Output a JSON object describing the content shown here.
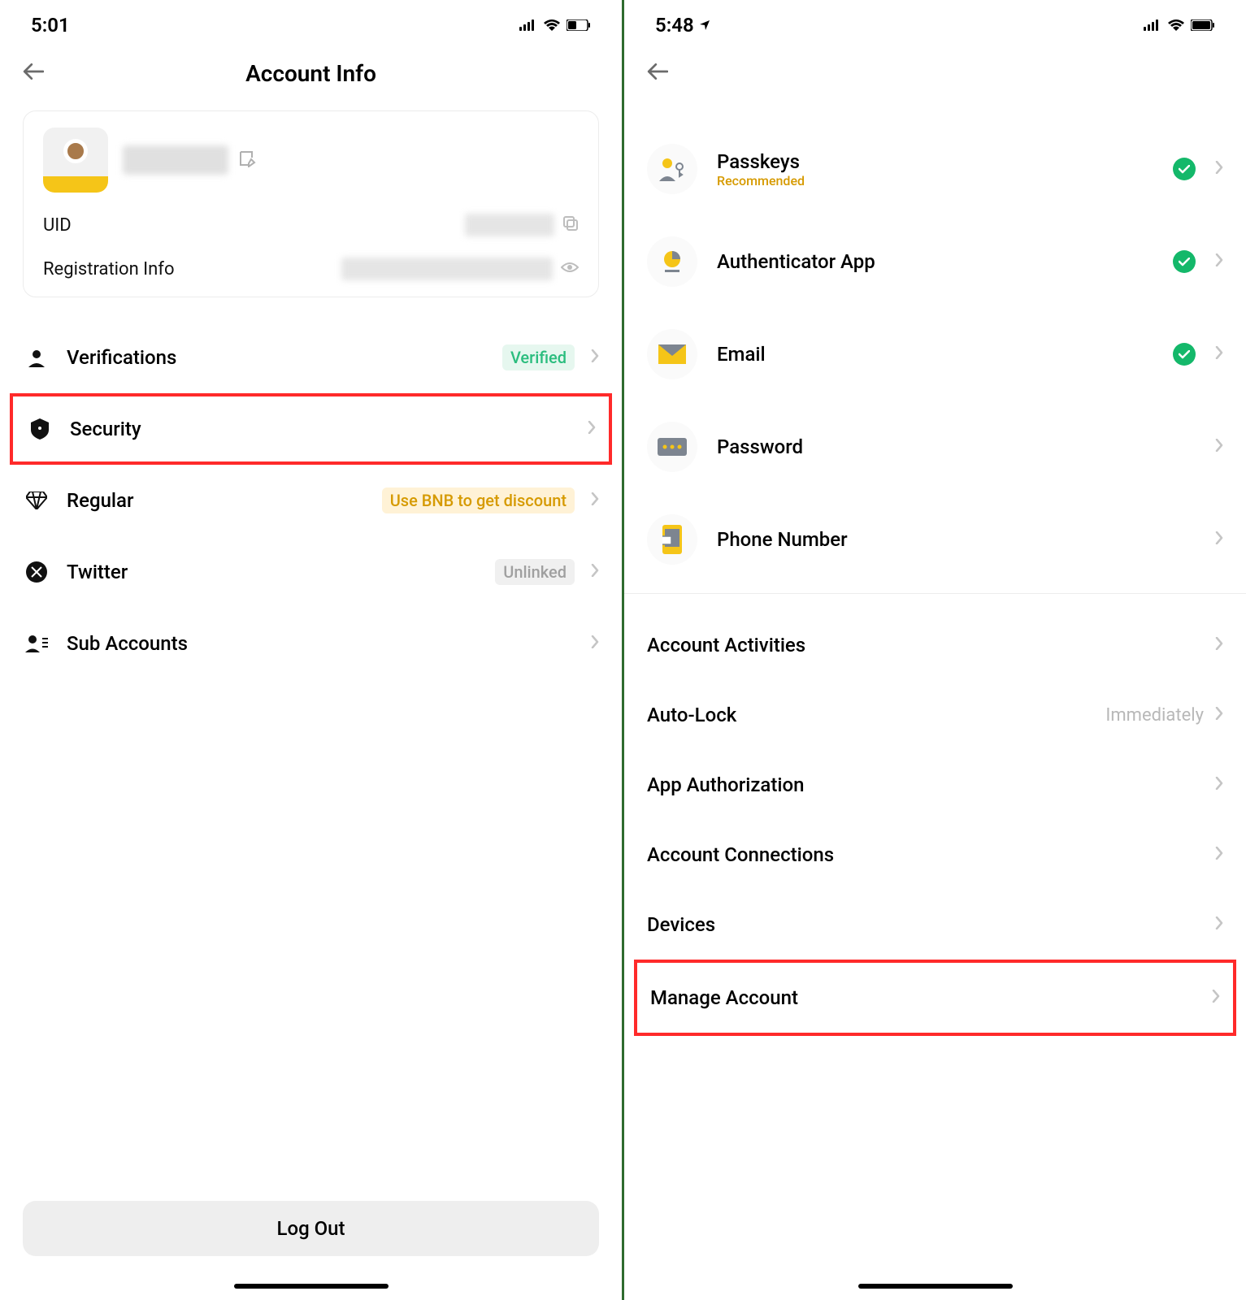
{
  "left": {
    "status": {
      "time": "5:01"
    },
    "title": "Account Info",
    "card": {
      "uid_label": "UID",
      "reg_label": "Registration Info"
    },
    "menu": {
      "verifications": {
        "label": "Verifications",
        "badge": "Verified"
      },
      "security": {
        "label": "Security"
      },
      "regular": {
        "label": "Regular",
        "badge": "Use BNB to get discount"
      },
      "twitter": {
        "label": "Twitter",
        "badge": "Unlinked"
      },
      "sub_accounts": {
        "label": "Sub Accounts"
      }
    },
    "logout": "Log Out"
  },
  "right": {
    "status": {
      "time": "5:48"
    },
    "security": {
      "passkeys": {
        "label": "Passkeys",
        "sub": "Recommended"
      },
      "authenticator": {
        "label": "Authenticator App"
      },
      "email": {
        "label": "Email"
      },
      "password": {
        "label": "Password"
      },
      "phone": {
        "label": "Phone Number"
      }
    },
    "list": {
      "activities": "Account Activities",
      "autolock": {
        "label": "Auto-Lock",
        "value": "Immediately"
      },
      "app_auth": "App Authorization",
      "connections": "Account Connections",
      "devices": "Devices",
      "manage": "Manage Account"
    }
  }
}
